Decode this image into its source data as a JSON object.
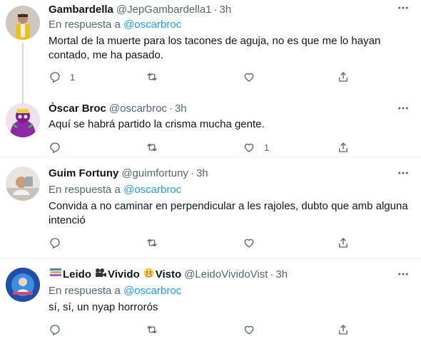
{
  "tweets": [
    {
      "name": "Gambardella",
      "handle": "@JepGambardella1",
      "time": "3h",
      "reply_prefix": "En respuesta a",
      "reply_to": "@oscarbroc",
      "text": "Mortal de la muerte para los tacones de aguja, no es que me lo hayan contado, me ha pasado.",
      "counts": {
        "reply": "1",
        "retweet": "",
        "like": ""
      }
    },
    {
      "name": "Òscar Broc",
      "handle": "@oscarbroc",
      "time": "3h",
      "text": "Aquí se habrá partido la crisma mucha gente.",
      "counts": {
        "reply": "",
        "retweet": "",
        "like": "1"
      }
    },
    {
      "name": "Guim Fortuny",
      "handle": "@guimfortuny",
      "time": "3h",
      "reply_prefix": "En respuesta a",
      "reply_to": "@oscarbroc",
      "text": "Convida a no caminar en perpendicular a les rajoles, dubto que amb alguna intenció",
      "counts": {
        "reply": "",
        "retweet": "",
        "like": ""
      }
    },
    {
      "name_parts": [
        "Leido",
        "Vivido",
        "Visto"
      ],
      "name_emojis": [
        "books",
        "movie-camera",
        "grimacing-face"
      ],
      "handle": "@LeidoVividoVist",
      "time": "3h",
      "reply_prefix": "En respuesta a",
      "reply_to": "@oscarbroc",
      "text": "sí, sí, un nyap horrorós",
      "counts": {
        "reply": "",
        "retweet": "",
        "like": ""
      }
    }
  ],
  "icons": {
    "reply": "reply-icon",
    "retweet": "retweet-icon",
    "like": "heart-icon",
    "share": "share-icon",
    "more": "more-dots-icon"
  },
  "colors": {
    "link": "#1d9bf0",
    "secondary": "#536471",
    "divider": "#eff3f4",
    "thread": "#cfd9de"
  }
}
